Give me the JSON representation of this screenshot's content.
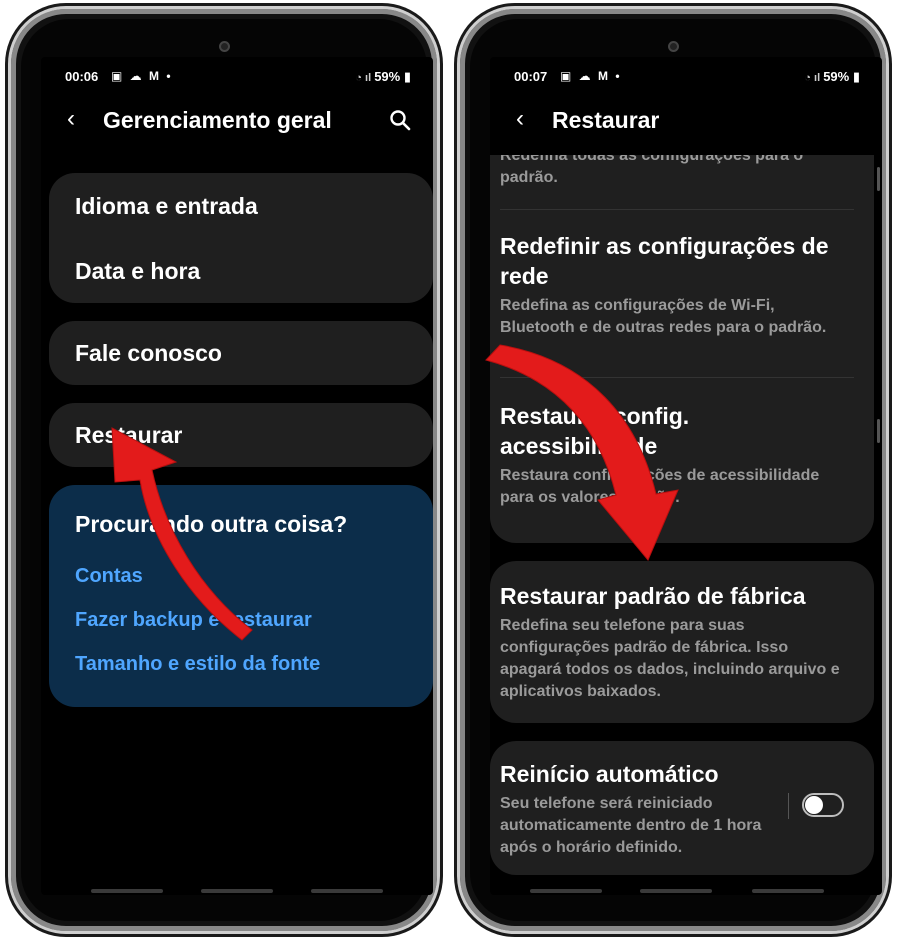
{
  "left": {
    "status": {
      "time": "00:06",
      "icons": "▣ ☁ M •",
      "wifi": "📶",
      "battery": "59%"
    },
    "appbar": {
      "back": "‹",
      "title": "Gerenciamento geral"
    },
    "group1": [
      "Idioma e entrada",
      "Data e hora"
    ],
    "fale": "Fale conosco",
    "restaurar": "Restaurar",
    "suggest": {
      "heading": "Procurando outra coisa?",
      "links": [
        "Contas",
        "Fazer backup e restaurar",
        "Tamanho e estilo da fonte"
      ]
    }
  },
  "right": {
    "status": {
      "time": "00:07",
      "icons": "▣ ☁ M •",
      "battery": "59%"
    },
    "appbar": {
      "back": "‹",
      "title": "Restaurar"
    },
    "partial_desc": "Redefina todas as configurações para o padrão.",
    "items": [
      {
        "title": "Redefinir as configurações de rede",
        "desc": "Redefina as configurações de Wi‑Fi, Bluetooth e de outras redes para o padrão."
      },
      {
        "title": "Restaurar config. acessibilidade",
        "desc": "Restaura configurações de acessibilidade para os valores padrão."
      },
      {
        "title": "Restaurar padrão de fábrica",
        "desc": "Redefina seu telefone para suas configurações padrão de fábrica. Isso apagará todos os dados, incluindo arquivo e aplicativos baixados."
      },
      {
        "title": "Reinício automático",
        "desc": "Seu telefone será reiniciado automaticamente dentro de 1 hora após o horário definido."
      }
    ]
  },
  "colors": {
    "arrow": "#e31b1b",
    "link": "#4fa6ff",
    "card": "#1f1f1f",
    "suggest_bg": "#0c2d4a"
  }
}
